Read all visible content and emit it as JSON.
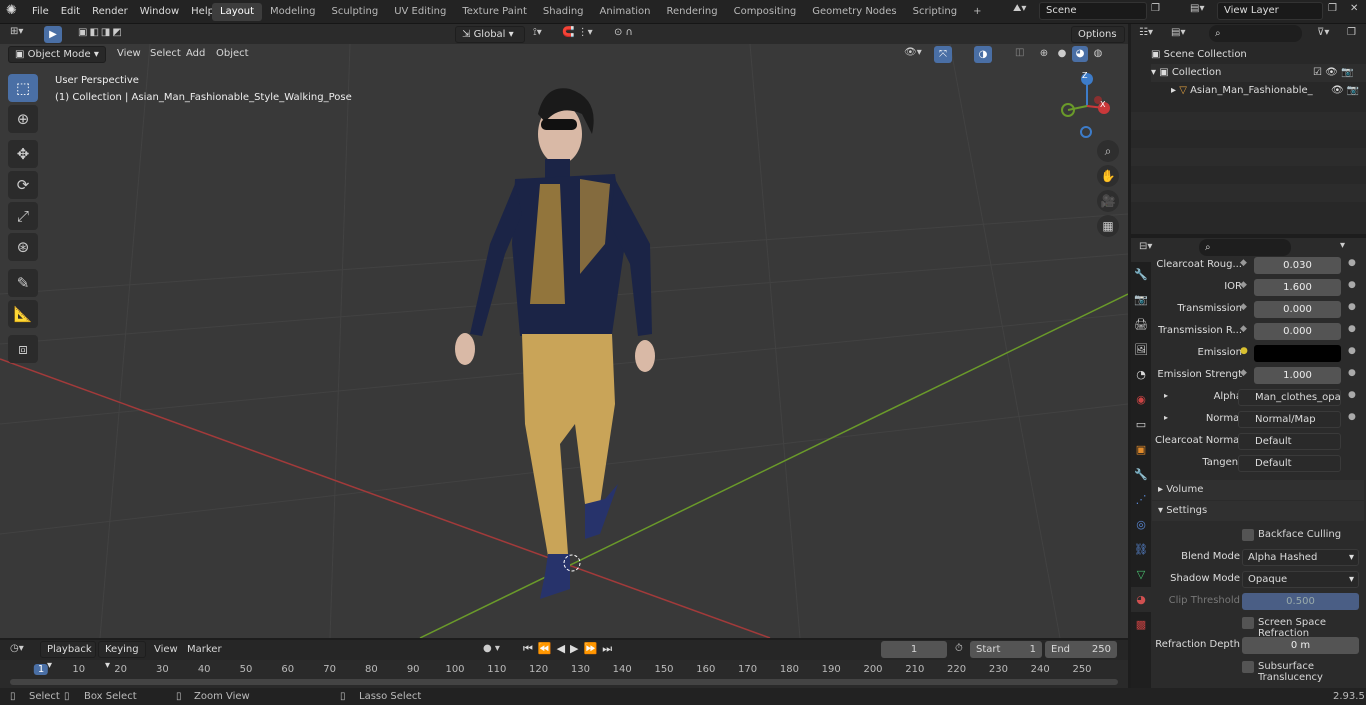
{
  "menubar": {
    "items": [
      "File",
      "Edit",
      "Render",
      "Window",
      "Help"
    ]
  },
  "workspaces": [
    "Layout",
    "Modeling",
    "Sculpting",
    "UV Editing",
    "Texture Paint",
    "Shading",
    "Animation",
    "Rendering",
    "Compositing",
    "Geometry Nodes",
    "Scripting"
  ],
  "workspace_active": "Layout",
  "scene": "Scene",
  "view_layer": "View Layer",
  "viewport": {
    "mode": "Object Mode",
    "menus": [
      "View",
      "Select",
      "Add",
      "Object"
    ],
    "orientation": "Global",
    "options": "Options",
    "info_title": "User Perspective",
    "info_sub": "(1) Collection | Asian_Man_Fashionable_Style_Walking_Pose",
    "gizmo": {
      "z": "Z",
      "x": "X"
    }
  },
  "outliner": {
    "scene_collection": "Scene Collection",
    "collection": "Collection",
    "object": "Asian_Man_Fashionable_"
  },
  "properties": {
    "rows": [
      {
        "label": "Clearcoat Roug...",
        "value": "0.030"
      },
      {
        "label": "IOR",
        "value": "1.600"
      },
      {
        "label": "Transmission",
        "value": "0.000"
      },
      {
        "label": "Transmission R...",
        "value": "0.000"
      },
      {
        "label": "Emission",
        "value": ""
      },
      {
        "label": "Emission Strengt",
        "value": "1.000"
      }
    ],
    "links": [
      {
        "label": "Alpha",
        "value": "Man_clothes_opacit..."
      },
      {
        "label": "Normal",
        "value": "Normal/Map"
      },
      {
        "label": "Clearcoat Normal",
        "value": "Default"
      },
      {
        "label": "Tangent",
        "value": "Default"
      }
    ],
    "volume": "Volume",
    "settings": "Settings",
    "backface": "Backface Culling",
    "blend_label": "Blend Mode",
    "blend_value": "Alpha Hashed",
    "shadow_label": "Shadow Mode",
    "shadow_value": "Opaque",
    "clip_label": "Clip Threshold",
    "clip_value": "0.500",
    "ssr": "Screen Space Refraction",
    "refr_label": "Refraction Depth",
    "refr_value": "0 m",
    "sss": "Subsurface Translucency"
  },
  "timeline": {
    "menus": [
      "Playback",
      "Keying",
      "View",
      "Marker"
    ],
    "current_frame": "1",
    "start_label": "Start",
    "start": "1",
    "end_label": "End",
    "end": "250",
    "ticks": [
      "1",
      "10",
      "20",
      "30",
      "40",
      "50",
      "60",
      "70",
      "80",
      "90",
      "100",
      "110",
      "120",
      "130",
      "140",
      "150",
      "160",
      "170",
      "180",
      "190",
      "200",
      "210",
      "220",
      "230",
      "240",
      "250"
    ]
  },
  "statusbar": {
    "select": "Select",
    "box": "Box Select",
    "zoom": "Zoom View",
    "lasso": "Lasso Select",
    "version": "2.93.5"
  },
  "colors": {
    "accent": "#4a6fa5",
    "xaxis": "#b23c3c",
    "yaxis": "#6a9a2a",
    "jacket": "#1b2446",
    "pants": "#c9a458",
    "gold": "#b08a3a"
  }
}
